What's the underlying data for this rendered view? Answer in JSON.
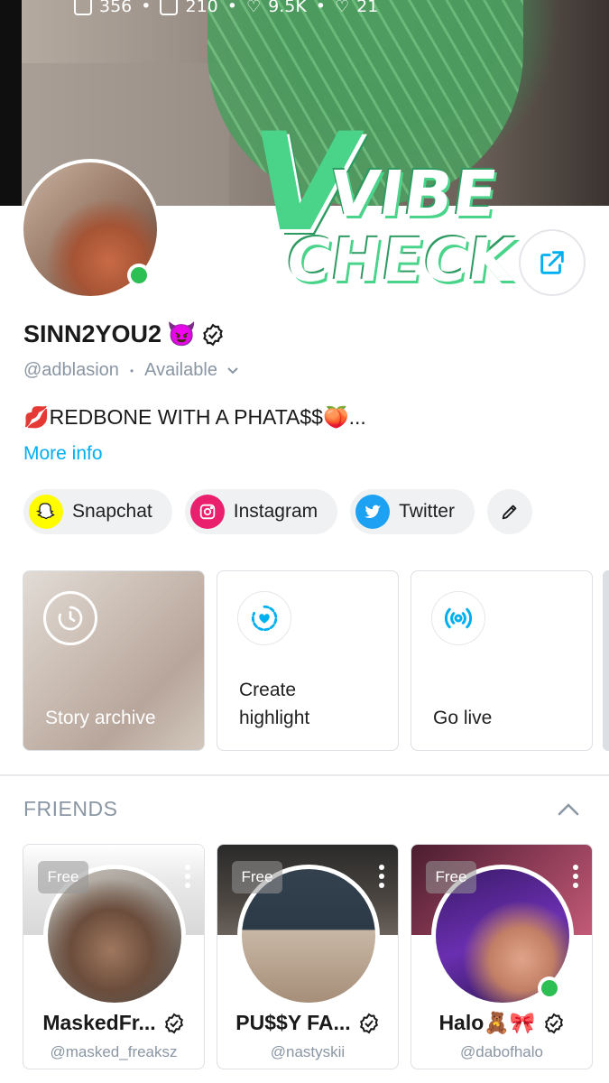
{
  "header": {
    "stats": [
      {
        "icon": "image-icon",
        "value": "356"
      },
      {
        "icon": "video-icon",
        "value": "210"
      },
      {
        "icon": "heart-icon",
        "value": "9.5K"
      },
      {
        "icon": "fans-icon",
        "value": "21"
      }
    ],
    "sticker": {
      "line1": "VIBE",
      "line2": "CHECK"
    }
  },
  "profile": {
    "name": "SINN2YOU2",
    "name_emoji": "😈",
    "handle": "@adblasion",
    "status": "Available",
    "bio": "💋REDBONE WITH A PHATA$$🍑...",
    "more_info": "More info"
  },
  "socials": [
    {
      "name": "Snapchat",
      "icon": "snapchat-icon"
    },
    {
      "name": "Instagram",
      "icon": "instagram-icon"
    },
    {
      "name": "Twitter",
      "icon": "twitter-icon"
    }
  ],
  "stories": [
    {
      "label": "Story archive",
      "icon": "clock-icon"
    },
    {
      "label": "Create highlight",
      "line1": "Create",
      "line2": "highlight",
      "icon": "highlight-heart-icon"
    },
    {
      "label": "Go live",
      "icon": "broadcast-icon"
    }
  ],
  "friends": {
    "title": "FRIENDS",
    "items": [
      {
        "name": "MaskedFr...",
        "handle": "@masked_freaksz",
        "badge": "Free"
      },
      {
        "name": "PU$$Y FA...",
        "handle": "@nastyskii",
        "badge": "Free"
      },
      {
        "name": "Halo🧸🎀",
        "handle": "@dabofhalo",
        "badge": "Free"
      }
    ]
  },
  "colors": {
    "accent": "#00aff0",
    "online": "#2dbf53",
    "muted": "#8a96a3",
    "sticker": "#49d48a"
  }
}
